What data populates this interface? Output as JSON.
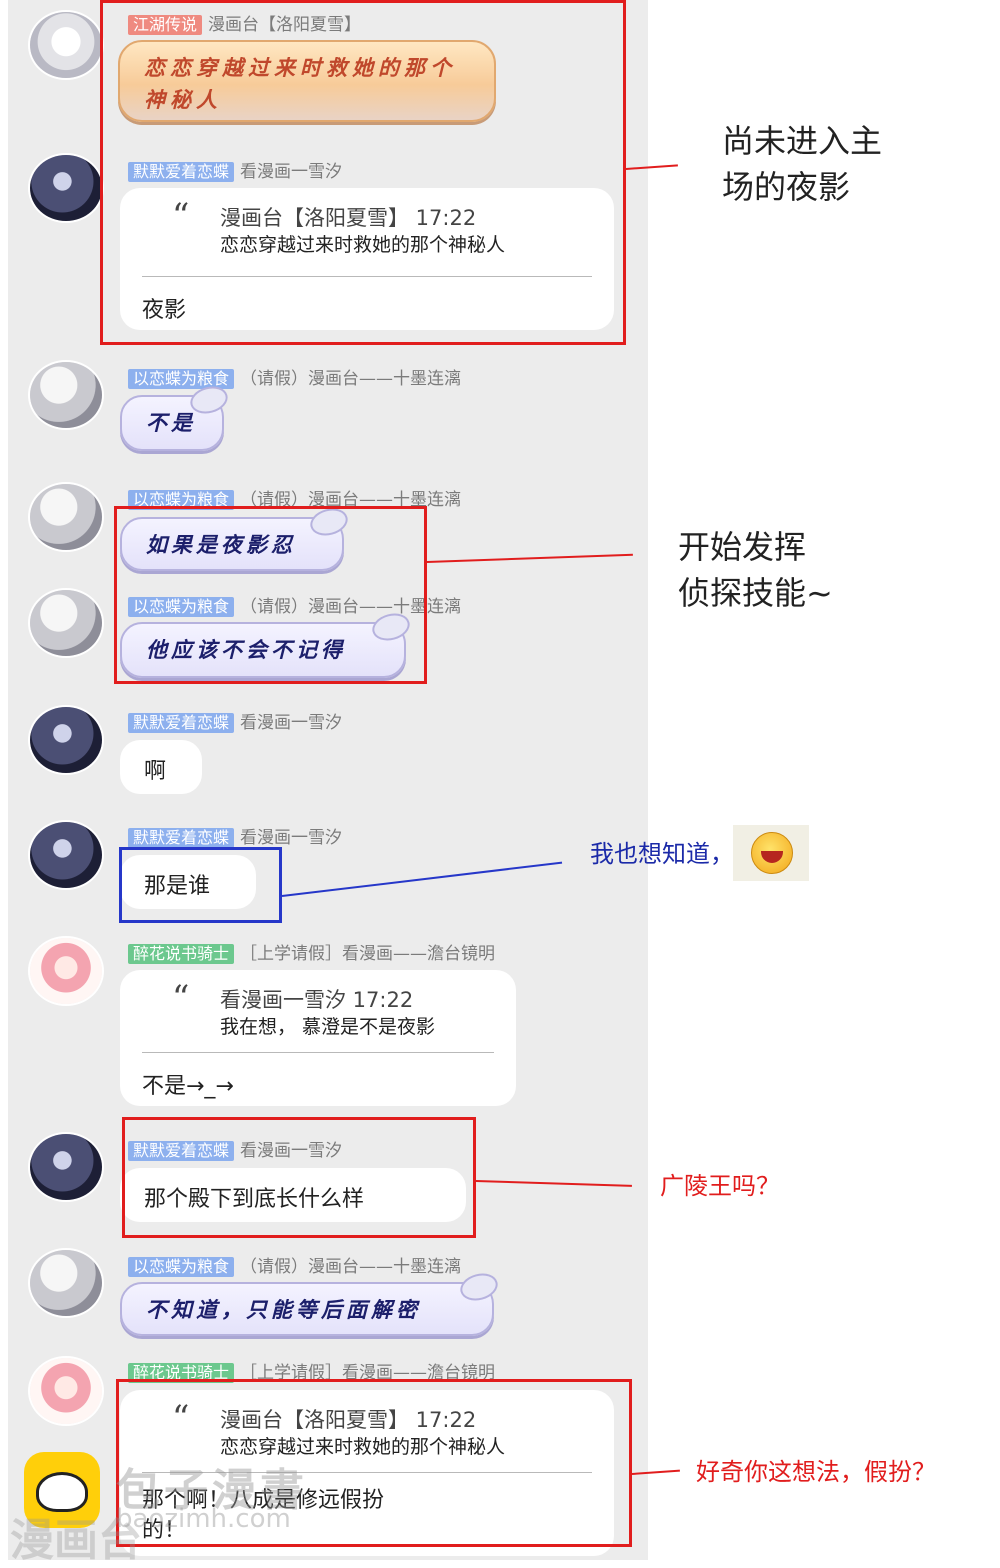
{
  "messages": [
    {
      "user_tag": "江湖传说",
      "user_title": "漫画台【洛阳夏雪】",
      "text": "恋恋穿越过来时救她的那个神秘人"
    },
    {
      "user_tag": "默默爱着恋蝶",
      "user_title": "看漫画一雪汐",
      "quote_meta": "漫画台【洛阳夏雪】 17:22",
      "quote_text": "恋恋穿越过来时救她的那个神秘人",
      "reply": "夜影"
    },
    {
      "user_tag": "以恋蝶为粮食",
      "user_title": "（请假）漫画台——十墨连漓",
      "text": "不是"
    },
    {
      "user_tag": "以恋蝶为粮食",
      "user_title": "（请假）漫画台——十墨连漓",
      "text": "如果是夜影忍"
    },
    {
      "user_tag": "以恋蝶为粮食",
      "user_title": "（请假）漫画台——十墨连漓",
      "text": "他应该不会不记得"
    },
    {
      "user_tag": "默默爱着恋蝶",
      "user_title": "看漫画一雪汐",
      "text": "啊"
    },
    {
      "user_tag": "默默爱着恋蝶",
      "user_title": "看漫画一雪汐",
      "text": "那是谁"
    },
    {
      "user_tag": "醉花说书骑士",
      "user_title": "［上学请假］看漫画——澹台镜明",
      "quote_meta": "看漫画一雪汐 17:22",
      "quote_text": "我在想， 慕澄是不是夜影",
      "reply": "不是→_→"
    },
    {
      "user_tag": "默默爱着恋蝶",
      "user_title": "看漫画一雪汐",
      "text": "那个殿下到底长什么样"
    },
    {
      "user_tag": "以恋蝶为粮食",
      "user_title": "（请假）漫画台——十墨连漓",
      "text": "不知道，只能等后面解密"
    },
    {
      "user_tag": "醉花说书骑士",
      "user_title": "［上学请假］看漫画——澹台镜明",
      "quote_meta": "漫画台【洛阳夏雪】 17:22",
      "quote_text": "恋恋穿越过来时救她的那个神秘人",
      "reply": "那个啊！八成是修远假扮\n的！"
    }
  ],
  "annotations": {
    "note1": "尚未进入主\n场的夜影",
    "note2": "开始发挥\n侦探技能~",
    "note3": "我也想知道，",
    "note4": "广陵王吗？",
    "note5": "好奇你这想法，假扮？"
  },
  "watermark": {
    "title": "包子漫書",
    "url": "baozimh.com",
    "side": "漫画台"
  },
  "colors": {
    "highlight_red": "#e11d1d",
    "highlight_blue": "#2637c9",
    "tag_blue": "#8db0ee",
    "tag_red": "#ef8a80",
    "tag_green": "#6cc88e",
    "chat_background": "#ececec"
  },
  "icons": {
    "emoji": "grinning-face-icon",
    "watermark_logo": "bun-logo-icon"
  }
}
